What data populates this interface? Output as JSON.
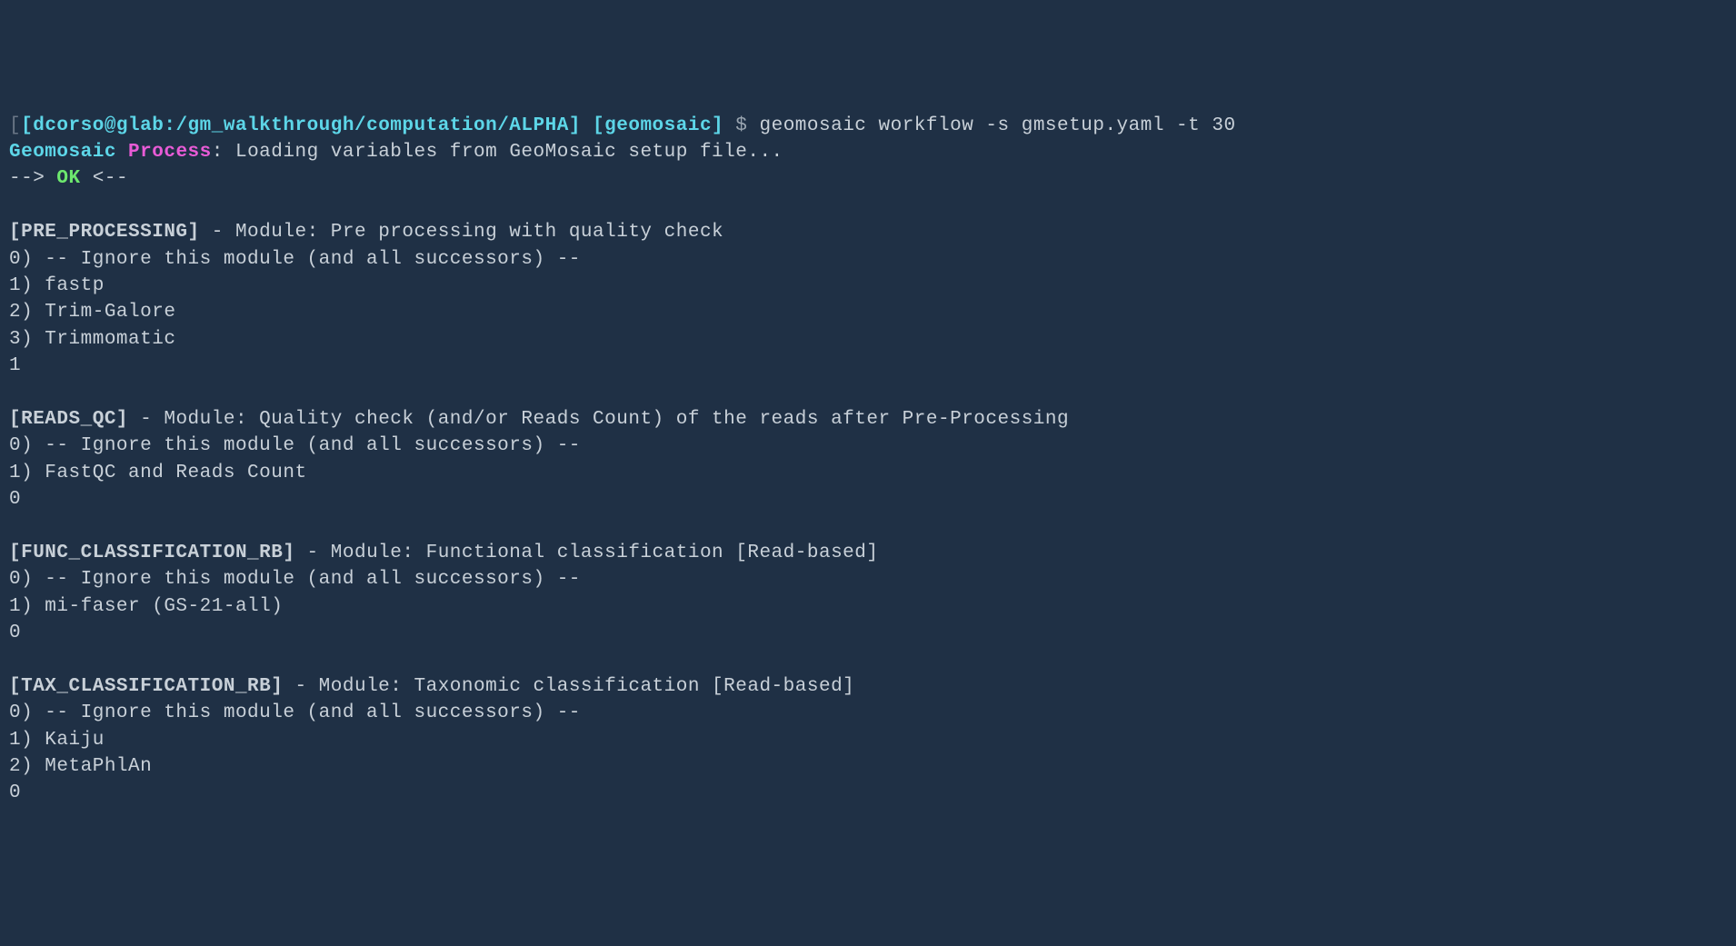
{
  "prompt": {
    "bracket_open": "[",
    "user_host": "[dcorso@glab",
    "colon": ":",
    "path": "/gm_walkthrough/computation/ALPHA",
    "bracket_close": "]",
    "app": " [geomosaic] ",
    "dollar": "$ ",
    "command": "geomosaic workflow -s gmsetup.yaml -t 30"
  },
  "status": {
    "prefix": "Geomosaic ",
    "word": "Process",
    "colon": ": ",
    "message": "Loading variables from GeoMosaic setup file...",
    "arrow_left": "--> ",
    "ok": "OK",
    "arrow_right": " <--"
  },
  "sections": [
    {
      "tag": "[PRE_PROCESSING]",
      "sep": " - ",
      "module_label": "Module: ",
      "module_desc": "Pre processing with quality check",
      "options": [
        "0) -- Ignore this module (and all successors) --",
        "1) fastp",
        "2) Trim-Galore",
        "3) Trimmomatic"
      ],
      "input": "1"
    },
    {
      "tag": "[READS_QC]",
      "sep": " - ",
      "module_label": "Module: ",
      "module_desc": "Quality check (and/or Reads Count) of the reads after Pre-Processing",
      "options": [
        "0) -- Ignore this module (and all successors) --",
        "1) FastQC and Reads Count"
      ],
      "input": "0"
    },
    {
      "tag": "[FUNC_CLASSIFICATION_RB]",
      "sep": " - ",
      "module_label": "Module: ",
      "module_desc": "Functional classification [Read-based]",
      "options": [
        "0) -- Ignore this module (and all successors) --",
        "1) mi-faser (GS-21-all)"
      ],
      "input": "0"
    },
    {
      "tag": "[TAX_CLASSIFICATION_RB]",
      "sep": " - ",
      "module_label": "Module: ",
      "module_desc": "Taxonomic classification [Read-based]",
      "options": [
        "0) -- Ignore this module (and all successors) --",
        "1) Kaiju",
        "2) MetaPhlAn"
      ],
      "input": "0"
    }
  ]
}
